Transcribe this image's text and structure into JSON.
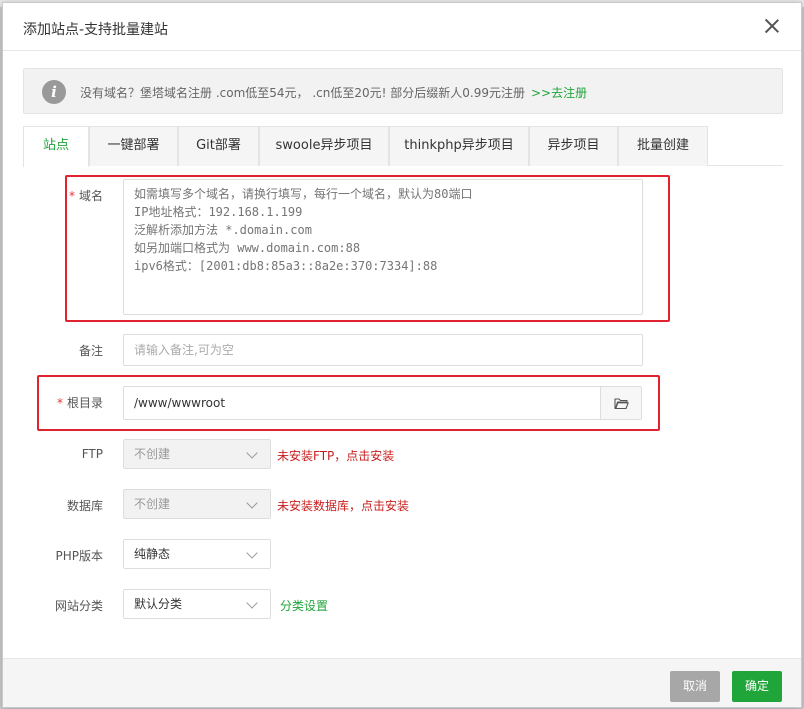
{
  "dialog": {
    "title": "添加站点-支持批量建站"
  },
  "notice": {
    "text": "没有域名？堡塔域名注册 .com低至54元， .cn低至20元! 部分后缀新人0.99元注册",
    "link": ">>去注册"
  },
  "tabs": [
    {
      "label": "站点",
      "active": true
    },
    {
      "label": "一键部署"
    },
    {
      "label": "Git部署"
    },
    {
      "label": "swoole异步项目"
    },
    {
      "label": "thinkphp异步项目"
    },
    {
      "label": "异步项目"
    },
    {
      "label": "批量创建"
    }
  ],
  "form": {
    "domain": {
      "required_mark": "*",
      "label": "域名",
      "placeholder": "如需填写多个域名，请换行填写，每行一个域名，默认为80端口\nIP地址格式：192.168.1.199\n泛解析添加方法 *.domain.com\n如另加端口格式为 www.domain.com:88\nipv6格式：[2001:db8:85a3::8a2e:370:7334]:88"
    },
    "remark": {
      "label": "备注",
      "placeholder": "请输入备注,可为空"
    },
    "root": {
      "required_mark": "*",
      "label": "根目录",
      "value": "/www/wwwroot",
      "icon": "folder-icon"
    },
    "ftp": {
      "label": "FTP",
      "value": "不创建",
      "hint": "未安装FTP，点击安装"
    },
    "database": {
      "label": "数据库",
      "value": "不创建",
      "hint": "未安装数据库，点击安装"
    },
    "php": {
      "label": "PHP版本",
      "value": "纯静态"
    },
    "category": {
      "label": "网站分类",
      "value": "默认分类",
      "hint": "分类设置"
    }
  },
  "footer": {
    "cancel": "取消",
    "ok": "确定"
  },
  "colors": {
    "accent": "#20a53a",
    "highlight": "#e0232f",
    "warning": "#c91e1e"
  }
}
